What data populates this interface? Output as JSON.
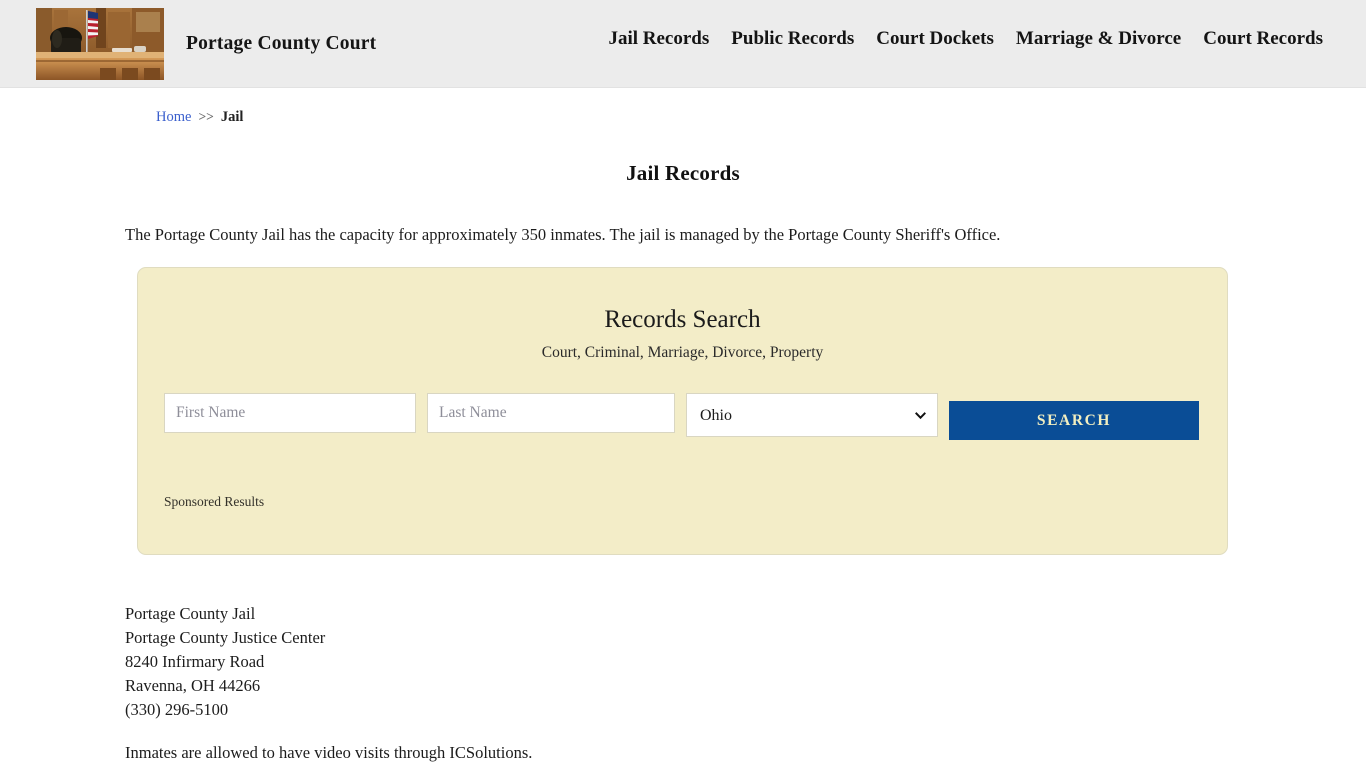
{
  "header": {
    "brand_name": "Portage County Court",
    "logo_alt": "courthouse-photo",
    "nav": [
      {
        "label": "Jail Records"
      },
      {
        "label": "Public Records"
      },
      {
        "label": "Court Dockets"
      },
      {
        "label": "Marriage & Divorce"
      },
      {
        "label": "Court Records"
      }
    ]
  },
  "breadcrumb": {
    "home_label": "Home",
    "separator": ">>",
    "current_label": "Jail"
  },
  "main": {
    "page_title": "Jail Records",
    "intro": "The Portage County Jail has the capacity for approximately 350 inmates. The jail is managed by the Portage County Sheriff's Office.",
    "address": {
      "line1": "Portage County Jail",
      "line2": "Portage County Justice Center",
      "line3": "8240 Infirmary Road",
      "line4": "Ravenna, OH 44266",
      "line5": "(330) 296-5100"
    },
    "visit_note": "Inmates are allowed to have video visits through ICSolutions."
  },
  "search_panel": {
    "title": "Records Search",
    "subtitle": "Court, Criminal, Marriage, Divorce, Property",
    "first_name_placeholder": "First Name",
    "first_name_value": "",
    "last_name_placeholder": "Last Name",
    "last_name_value": "",
    "state_selected": "Ohio",
    "search_button_label": "SEARCH",
    "sponsored_label": "Sponsored Results",
    "colors": {
      "panel_background": "#f3edc8",
      "button_background": "#0a4d96",
      "button_text": "#f2eec0",
      "link": "#3a5fcd"
    }
  }
}
